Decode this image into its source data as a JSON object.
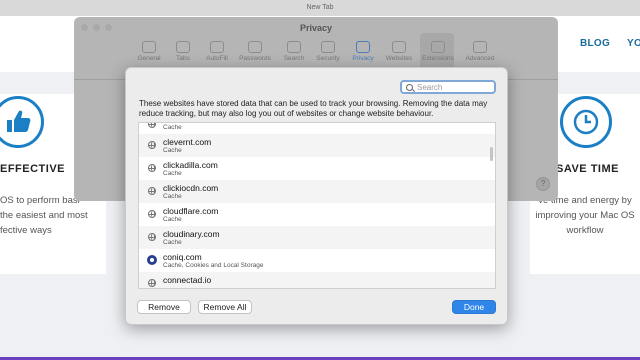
{
  "browser": {
    "tab_title": "New Tab"
  },
  "site": {
    "nav": [
      "BLOG",
      "YO"
    ],
    "features": [
      {
        "title": "EFFECTIVE",
        "icon": "thumbs-up-icon",
        "lines": [
          "OS to perform basi",
          "the easiest and most",
          "fective ways"
        ]
      },
      {
        "title": "SAVE TIME",
        "icon": "clock-icon",
        "lines": [
          "ve time and energy by",
          "improving your Mac OS",
          "workflow"
        ]
      }
    ],
    "accent": "#1a7fc4"
  },
  "prefs": {
    "title": "Privacy",
    "toolbar": [
      {
        "label": "General",
        "icon": "general-icon"
      },
      {
        "label": "Tabs",
        "icon": "tabs-icon"
      },
      {
        "label": "AutoFill",
        "icon": "autofill-icon"
      },
      {
        "label": "Passwords",
        "icon": "key-icon"
      },
      {
        "label": "Search",
        "icon": "search-icon"
      },
      {
        "label": "Security",
        "icon": "lock-icon"
      },
      {
        "label": "Privacy",
        "icon": "hand-icon"
      },
      {
        "label": "Websites",
        "icon": "globe-icon"
      },
      {
        "label": "Extensions",
        "icon": "puzzle-icon"
      },
      {
        "label": "Advanced",
        "icon": "gears-icon"
      }
    ],
    "active_tab": "Privacy",
    "help": "?"
  },
  "sheet": {
    "search_placeholder": "Search",
    "description": "These websites have stored data that can be used to track your browsing. Removing the data may reduce tracking, but may also log you out of websites or change website behaviour.",
    "rows": [
      {
        "name": "",
        "kind": "Cache",
        "icon": "globe-icon"
      },
      {
        "name": "clevernt.com",
        "kind": "Cache",
        "icon": "globe-icon"
      },
      {
        "name": "clickadilla.com",
        "kind": "Cache",
        "icon": "globe-icon"
      },
      {
        "name": "clickiocdn.com",
        "kind": "Cache",
        "icon": "globe-icon"
      },
      {
        "name": "cloudflare.com",
        "kind": "Cache",
        "icon": "globe-icon"
      },
      {
        "name": "cloudinary.com",
        "kind": "Cache",
        "icon": "globe-icon"
      },
      {
        "name": "coniq.com",
        "kind": "Cache, Cookies and Local Storage",
        "icon": "coniq-icon"
      },
      {
        "name": "connectad.io",
        "kind": "",
        "icon": "globe-icon"
      }
    ],
    "buttons": {
      "remove": "Remove",
      "remove_all": "Remove All",
      "done": "Done"
    }
  }
}
